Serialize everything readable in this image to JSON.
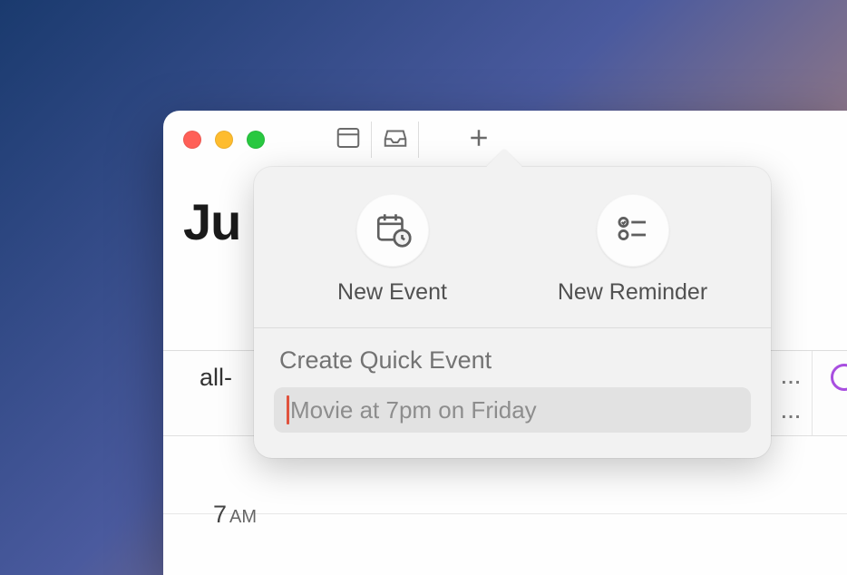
{
  "window": {
    "month_title_visible": "Ju"
  },
  "toolbar": {
    "sidebar_icon": "calendar-grid",
    "inbox_icon": "tray",
    "add_icon": "plus"
  },
  "allday": {
    "label_visible": "all-"
  },
  "hours": {
    "first_visible_number": "7",
    "first_visible_ampm": "AM"
  },
  "popover": {
    "tabs": {
      "new_event_label": "New Event",
      "new_reminder_label": "New Reminder"
    },
    "quick_title": "Create Quick Event",
    "quick_placeholder": "Movie at 7pm on Friday"
  },
  "colors": {
    "accent_purple": "#a84ee0",
    "cursor_red": "#e0523d"
  }
}
